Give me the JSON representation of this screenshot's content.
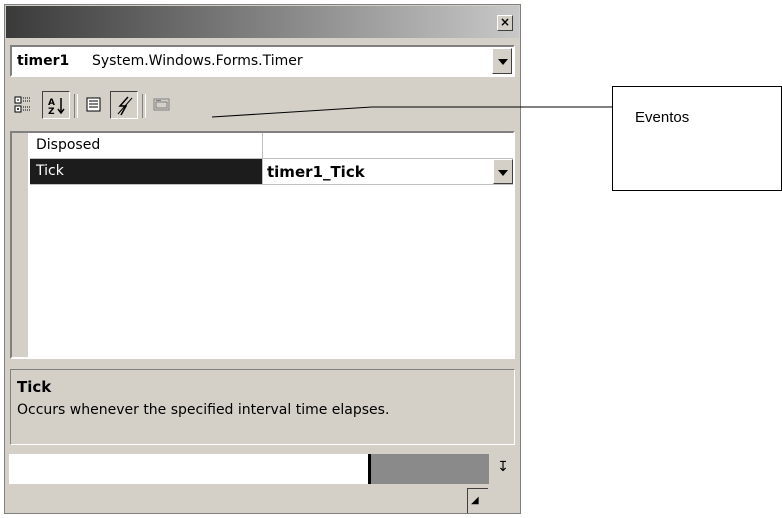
{
  "titlebar": {
    "close_glyph": "×"
  },
  "object_combo": {
    "name": "timer1",
    "type": "System.Windows.Forms.Timer"
  },
  "toolbar": {
    "buttons": [
      "categorized-icon",
      "alphabetical-icon",
      "properties-icon",
      "events-icon",
      "property-pages-icon"
    ],
    "pressed": [
      "alphabetical",
      "events"
    ]
  },
  "grid": {
    "rows": [
      {
        "name": "Disposed",
        "value": ""
      },
      {
        "name": "Tick",
        "value": "timer1_Tick"
      }
    ],
    "selected": "Tick"
  },
  "description": {
    "title": "Tick",
    "text": "Occurs whenever the specified interval time elapses."
  },
  "callout": {
    "label": "Eventos"
  }
}
